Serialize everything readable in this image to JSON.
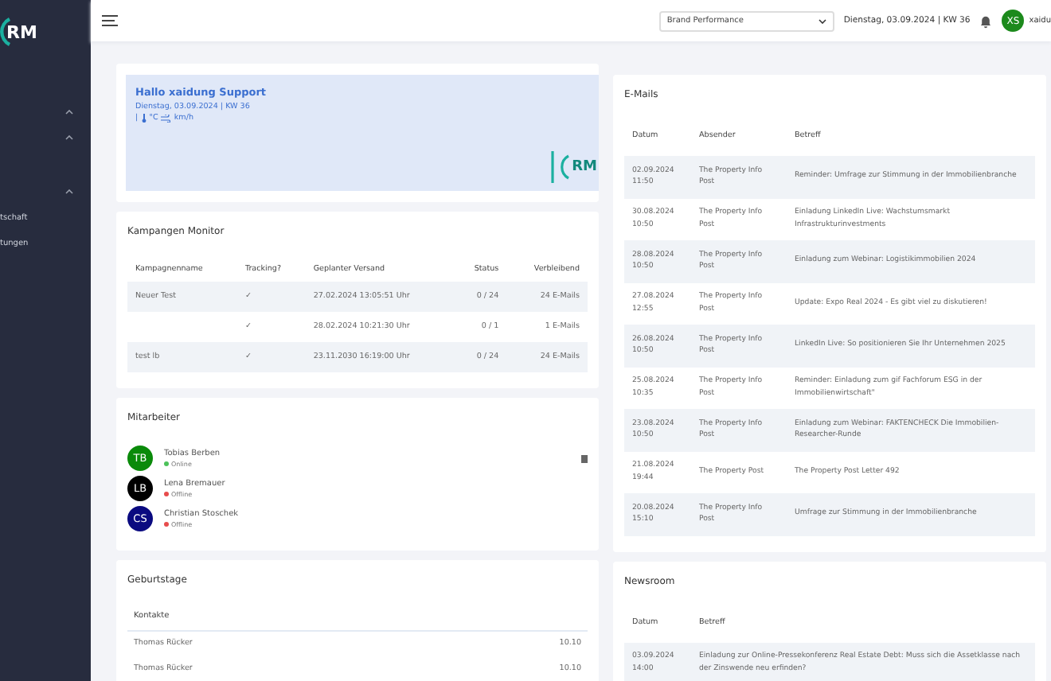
{
  "sidebar": {
    "logo": "RM",
    "items": [
      {
        "kind": "group"
      },
      {
        "kind": "group"
      },
      {
        "kind": "spacer"
      },
      {
        "kind": "group"
      },
      {
        "kind": "link",
        "label": "tschaft"
      },
      {
        "kind": "link",
        "label": "tungen"
      }
    ]
  },
  "topbar": {
    "dropdown": {
      "value": "Brand Performance"
    },
    "date": "Dienstag, 03.09.2024 | KW 36",
    "user": {
      "initials": "XS",
      "name": "xaidu"
    }
  },
  "welcome": {
    "title": "Hallo xaidung Support",
    "date": "Dienstag, 03.09.2024 | KW 36",
    "weather": {
      "separator": "|",
      "temperature": "°C",
      "wind": "km/h"
    },
    "logo": "RM"
  },
  "campaigns": {
    "title": "Kampangen Monitor",
    "columns": [
      "Kampagnenname",
      "Tracking?",
      "Geplanter Versand",
      "Status",
      "Verbleibend"
    ],
    "rows": [
      {
        "name": "Neuer Test",
        "tracking": "✓",
        "date": "27.02.2024 13:05:51 Uhr",
        "status": "0 / 24",
        "remaining": "24 E-Mails"
      },
      {
        "tracking": "✓",
        "date": "28.02.2024 10:21:30 Uhr",
        "status": "0 / 1",
        "remaining": "1 E-Mails"
      },
      {
        "name": "test lb",
        "tracking": "✓",
        "date": "23.11.2030 16:19:00 Uhr",
        "status": "0 / 24",
        "remaining": "24 E-Mails"
      }
    ]
  },
  "employees": {
    "title": "Mitarbeiter",
    "items": [
      {
        "name": "Tobias Berben",
        "avatar": {
          "initials": "TB",
          "color": "#0a8a0a"
        },
        "status": {
          "label": "Online",
          "color": "#4cc25a"
        }
      },
      {
        "name": "Lena Bremauer",
        "avatar": {
          "initials": "LB",
          "color": "#000000"
        },
        "status": {
          "label": "Offline",
          "color": "#e74c4c"
        }
      },
      {
        "name": "Christian Stoschek",
        "avatar": {
          "initials": "CS",
          "color": "#0a0a80"
        },
        "status": {
          "label": "Offline",
          "color": "#e74c4c"
        }
      }
    ]
  },
  "birthdays": {
    "title": "Geburtstage",
    "column": "Kontakte",
    "rows": [
      {
        "name": "Thomas Rücker",
        "date": "10.10"
      },
      {
        "name": "Thomas Rücker",
        "date": "10.10"
      }
    ]
  },
  "emails": {
    "title": "E-Mails",
    "columns": [
      "Datum",
      "Absender",
      "Betreff"
    ],
    "rows": [
      {
        "date": "02.09.2024\n11:50",
        "sender": "The Property Info Post",
        "subject": "Reminder: Umfrage zur Stimmung in der Immobilienbranche"
      },
      {
        "date": "30.08.2024\n10:50",
        "sender": "The Property Info Post",
        "subject": "Einladung LinkedIn Live: Wachstumsmarkt Infrastrukturinvestments"
      },
      {
        "date": "28.08.2024\n10:50",
        "sender": "The Property Info Post",
        "subject": "Einladung zum Webinar: Logistikimmobilien 2024"
      },
      {
        "date": "27.08.2024\n12:55",
        "sender": "The Property Info Post",
        "subject": "Update: Expo Real 2024 - Es gibt viel zu diskutieren!"
      },
      {
        "date": "26.08.2024\n10:50",
        "sender": "The Property Info Post",
        "subject": "LinkedIn Live: So positionieren Sie Ihr Unternehmen 2025"
      },
      {
        "date": "25.08.2024\n10:35",
        "sender": "The Property Info Post",
        "subject": "Reminder: Einladung zum gif Fachforum ESG in der Immobilienwirtschaft\""
      },
      {
        "date": "23.08.2024\n10:50",
        "sender": "The Property Info Post",
        "subject": "Einladung zum Webinar: FAKTENCHECK  Die Immobilien-Researcher-Runde"
      },
      {
        "date": "21.08.2024\n19:44",
        "sender": "The Property Post",
        "subject": "The Property Post Letter 492"
      },
      {
        "date": "20.08.2024\n15:10",
        "sender": "The Property Info Post",
        "subject": "Umfrage zur Stimmung in der Immobilienbranche"
      }
    ]
  },
  "newsroom": {
    "title": "Newsroom",
    "columns": [
      "Datum",
      "Betreff"
    ],
    "rows": [
      {
        "date": "03.09.2024\n14:00",
        "subject": "Einladung zur Online-Pressekonferenz Real Estate Debt: Muss sich die Assetklasse nach der Zinswende neu erfinden?"
      }
    ]
  }
}
